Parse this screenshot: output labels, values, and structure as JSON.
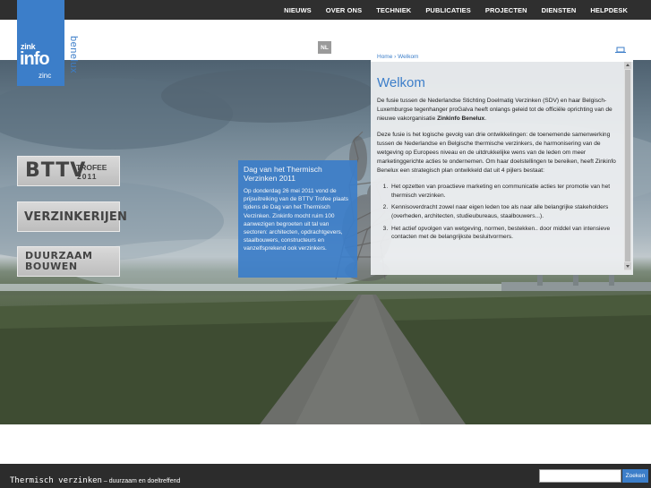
{
  "nav": {
    "items": [
      "NIEUWS",
      "OVER ONS",
      "TECHNIEK",
      "PUBLICATIES",
      "PROJECTEN",
      "DIENSTEN",
      "HELPDESK"
    ]
  },
  "logo": {
    "zinc_top": "zink",
    "info": "info",
    "zinc_bottom": "zinc",
    "region": "benelux",
    "brand_color": "#3c7ec9"
  },
  "language": {
    "label": "NL"
  },
  "icons": {
    "print": "printer-icon"
  },
  "side_buttons": {
    "bttv": {
      "main": "BTTV",
      "trofee": "TROFEE",
      "year": "2011"
    },
    "verzinkerijen": {
      "main": "VERZINKERIJEN"
    },
    "duurzaam": {
      "line1": "DUURZAAM",
      "line2": "BOUWEN"
    }
  },
  "news": {
    "title": "Dag van het Thermisch Verzinken 2011",
    "text": "Op donderdag 26 mei 2011 vond de prijsuitreiking van de BTTV Trofee plaats tijdens de Dag van het Thermisch Verzinken. Zinkinfo mocht ruim 100 aanwezigen begroeten uit tal van sectoren: architecten, opdrachtgevers, staalbouwers, constructeurs en vanzelfsprekend ook verzinkers."
  },
  "content": {
    "breadcrumb": "Home › Welkom",
    "title": "Welkom",
    "p1_before": "De fusie tussen de Nederlandse Stichting Doelmatig Verzinken (SDV) en haar Belgisch-Luxemburgse tegenhanger proGalva heeft onlangs geleid tot de officiële oprichting van de nieuwe vakorganisatie ",
    "p1_bold": "Zinkinfo Benelux",
    "p1_after": ".",
    "p2": "Deze fusie is het logische gevolg van drie ontwikkelingen: de toenemende samenwerking tussen de Nederlandse en Belgische thermische verzinkers, de harmonisering van de wetgeving op Europees niveau en de uitdrukkelijke wens van de leden om meer marketinggerichte acties te ondernemen. Om haar doelstellingen te bereiken, heeft Zinkinfo Benelux een strategisch plan ontwikkeld dat uit 4 pijlers bestaat:",
    "list": [
      "Het opzetten van proactieve marketing en communicatie acties ter promotie van het thermisch verzinken.",
      "Kennisoverdracht zowel naar eigen leden toe als naar alle belangrijke stakeholders (overheden, architecten, studieubureaus, staalbouwers...).",
      "Het actief opvolgen van wetgeving, normen, bestekken.. door middel van intensieve contacten met de belangrijkste besluitvormers."
    ]
  },
  "footer": {
    "tagline_main": "Thermisch verzinken",
    "tagline_sub": " – duurzaam en doeltreffend",
    "search_placeholder": "",
    "search_button": "Zoeken"
  }
}
